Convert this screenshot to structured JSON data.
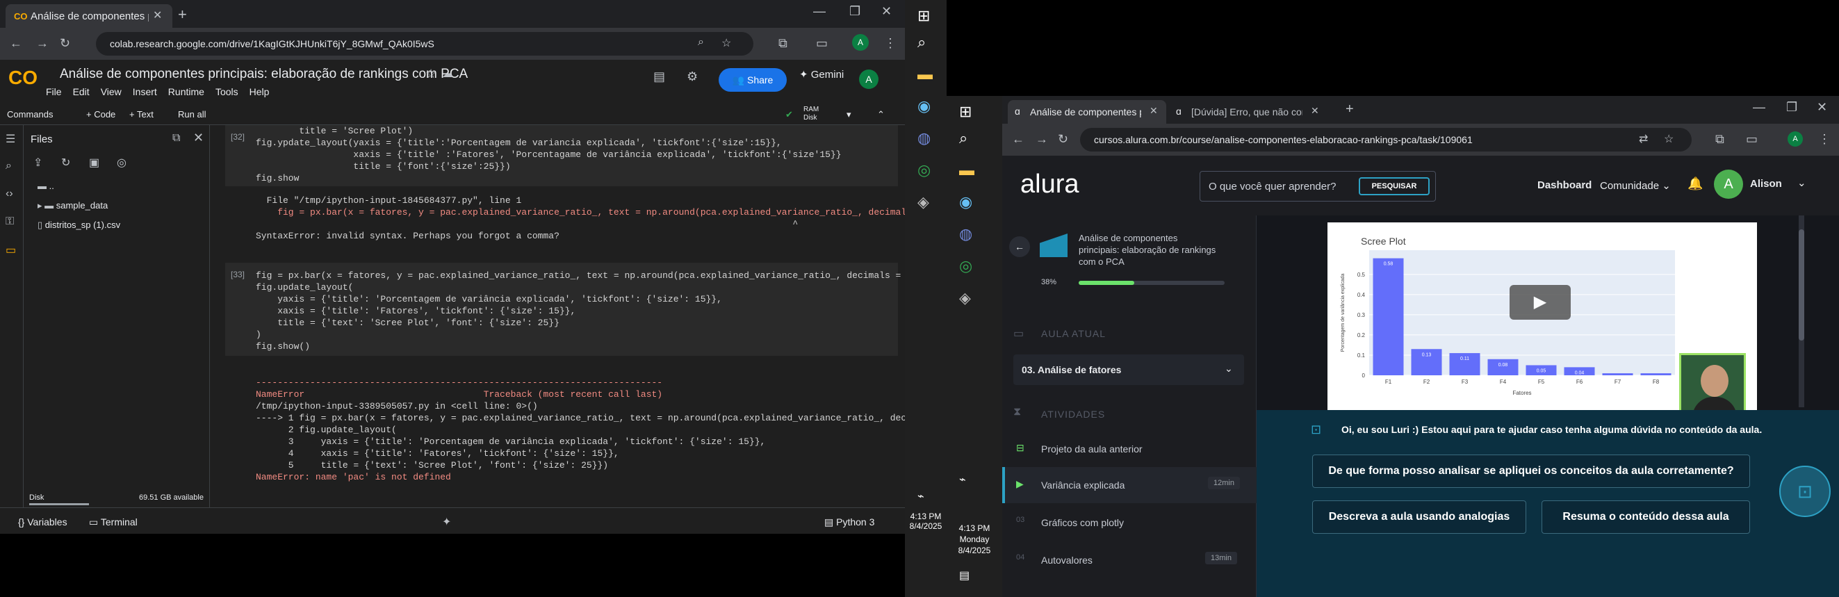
{
  "left_browser": {
    "tab_title": "Análise de componentes princi...",
    "url": "colab.research.google.com/drive/1KagIGtKJHUnkiT6jY_8GMwf_QAk0I5wS",
    "notebook_title": "Análise de componentes  principais: elaboração de rankings com PCA",
    "menu": [
      "File",
      "Edit",
      "View",
      "Insert",
      "Runtime",
      "Tools",
      "Help"
    ],
    "share": "Share",
    "gemini": "Gemini",
    "avatar": "A",
    "commands": "Commands",
    "add_code": "+ Code",
    "add_text": "+ Text",
    "run_all": "Run all",
    "ram": "RAM",
    "disk": "Disk",
    "files_title": "Files",
    "files": [
      "..",
      "sample_data",
      "distritos_sp (1).csv"
    ],
    "disk_label": "Disk",
    "disk_available": "69.51 GB available",
    "variables": "Variables",
    "terminal": "Terminal",
    "python": "Python 3"
  },
  "cells": {
    "c32_num": "[32]",
    "c32_lines": [
      "        title = 'Scree Plot')",
      "fig.ypdate_layout(yaxis = {'title':'Porcentagem de variancia explicada', 'tickfont':{'size':15}},",
      "                  xaxis = {'title' :'Fatores', 'Porcentagame de variância explicada', 'tickfont':{'size'15}}",
      "                  title = {'font':{'size':25}})",
      "fig.show"
    ],
    "c32_out": [
      "  File \"/tmp/ipython-input-1845684377.py\", line 1",
      "    fig = px.bar(x = fatores, y = pac.explained_variance_ratio_, text = np.around(pca.explained_variance_ratio_, decimals = 2)",
      "                                                                                                   ^",
      "SyntaxError: invalid syntax. Perhaps you forgot a comma?"
    ],
    "c33_num": "[33]",
    "c33_lines": [
      "fig = px.bar(x = fatores, y = pac.explained_variance_ratio_, text = np.around(pca.explained_variance_ratio_, decimals = 2))",
      "fig.update_layout(",
      "    yaxis = {'title': 'Porcentagem de variância explicada', 'tickfont': {'size': 15}},",
      "    xaxis = {'title': 'Fatores', 'tickfont': {'size': 15}},",
      "    title = {'text': 'Scree Plot', 'font': {'size': 25}}",
      ")",
      "fig.show()"
    ],
    "c33_out": [
      "---------------------------------------------------------------------------",
      "NameError                                 Traceback (most recent call last)",
      "/tmp/ipython-input-3389505057.py in <cell line: 0>()",
      "----> 1 fig = px.bar(x = fatores, y = pac.explained_variance_ratio_, text = np.around(pca.explained_variance_ratio_, decimals = 2))",
      "      2 fig.update_layout(",
      "      3     yaxis = {'title': 'Porcentagem de variância explicada', 'tickfont': {'size': 15}},",
      "      4     xaxis = {'title': 'Fatores', 'tickfont': {'size': 15}},",
      "      5     title = {'text': 'Scree Plot', 'font': {'size': 25}})",
      "",
      "NameError: name 'pac' is not defined"
    ]
  },
  "taskbar": {
    "time1": "4:13 PM",
    "date1": "8/4/2025",
    "time2": "4:13 PM",
    "day2": "Monday",
    "date2": "8/4/2025"
  },
  "right_browser": {
    "tab1": "Análise de componentes princip...",
    "tab2": "[Dúvida] Erro, que não compre...",
    "url": "cursos.alura.com.br/course/analise-componentes-elaboracao-rankings-pca/task/109061",
    "logo": "alura",
    "search_placeholder": "O que você quer aprender?",
    "search_btn": "PESQUISAR",
    "dashboard": "Dashboard",
    "comunidade": "Comunidade",
    "user": "Alison",
    "avatar": "A",
    "course_title": "Análise de componentes principais: elaboração de rankings com o PCA",
    "progress_text": "38%",
    "progress": 0.38,
    "aula_atual": "AULA ATUAL",
    "current_lesson": "03. Análise de fatores",
    "atividades": "ATIVIDADES",
    "activities": [
      {
        "num": "01",
        "title": "Projeto da aula anterior",
        "time": ""
      },
      {
        "num": "02",
        "title": "Variância explicada",
        "time": "12min"
      },
      {
        "num": "03",
        "title": "Gráficos com plotly",
        "time": ""
      },
      {
        "num": "04",
        "title": "Autovalores",
        "time": "13min"
      }
    ],
    "video": {
      "chart_title": "Scree Plot",
      "ylabel": "Porcentagem de variância explicada",
      "xlabel": "Fatores"
    },
    "chat_greeting": "Oi, eu sou Luri :) Estou aqui para te ajudar caso tenha alguma dúvida no conteúdo da aula.",
    "q1": "De que forma posso analisar se apliquei os conceitos da aula corretamente?",
    "q2": "Descreva a aula usando analogias",
    "q3": "Resuma o conteúdo dessa aula"
  },
  "chart_data": {
    "type": "bar",
    "title": "Scree Plot",
    "xlabel": "Fatores",
    "ylabel": "Porcentagem de variância explicada",
    "categories": [
      "F1",
      "F2",
      "F3",
      "F4",
      "F5",
      "F6",
      "F7",
      "F8"
    ],
    "values": [
      0.58,
      0.13,
      0.11,
      0.08,
      0.05,
      0.04,
      0.01,
      0.01
    ],
    "labels": [
      "0.58",
      "0.13",
      "0.11",
      "0.08",
      "0.05",
      "0.04",
      "0.01",
      "0.01"
    ],
    "yticks": [
      "0",
      "0.1",
      "0.2",
      "0.3",
      "0.4",
      "0.5"
    ],
    "ylim": [
      0,
      0.62
    ]
  },
  "colors": {
    "colab_bg": "#1f1f1f",
    "alura_bg": "#1c1d21",
    "alura_accent": "#2da1c4",
    "bar": "#636efa",
    "share": "#1a73e8"
  }
}
